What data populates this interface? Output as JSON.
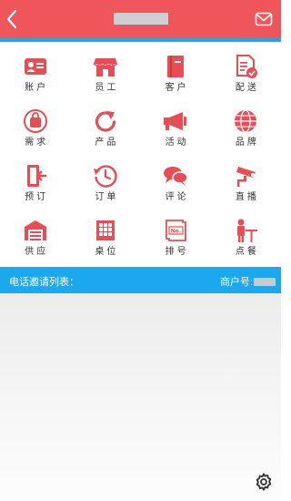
{
  "header": {
    "back_icon": "chevron-left-icon",
    "mail_icon": "mail-icon"
  },
  "colors": {
    "header": "#f0555b",
    "accent": "#1ca8ee",
    "icon": "#e84c55"
  },
  "grid": {
    "items": [
      {
        "label": "账户",
        "icon": "account-card-icon"
      },
      {
        "label": "员工",
        "icon": "shop-icon"
      },
      {
        "label": "客户",
        "icon": "book-icon"
      },
      {
        "label": "配送",
        "icon": "delivery-check-icon"
      },
      {
        "label": "需求",
        "icon": "bag-icon"
      },
      {
        "label": "产品",
        "icon": "refresh-icon"
      },
      {
        "label": "活动",
        "icon": "megaphone-icon"
      },
      {
        "label": "品牌",
        "icon": "globe-icon"
      },
      {
        "label": "预订",
        "icon": "exit-door-icon"
      },
      {
        "label": "订单",
        "icon": "clock-history-icon"
      },
      {
        "label": "评论",
        "icon": "chat-bubbles-icon"
      },
      {
        "label": "直播",
        "icon": "camera-icon"
      },
      {
        "label": "供应",
        "icon": "warehouse-icon"
      },
      {
        "label": "桌位",
        "icon": "table-grid-icon"
      },
      {
        "label": "排号",
        "icon": "number-ticket-icon"
      },
      {
        "label": "点餐",
        "icon": "waiter-icon"
      }
    ]
  },
  "call_list": {
    "title": "电话邀请列表：",
    "merchant_label": "商户号:"
  },
  "settings_icon": "gear-icon"
}
